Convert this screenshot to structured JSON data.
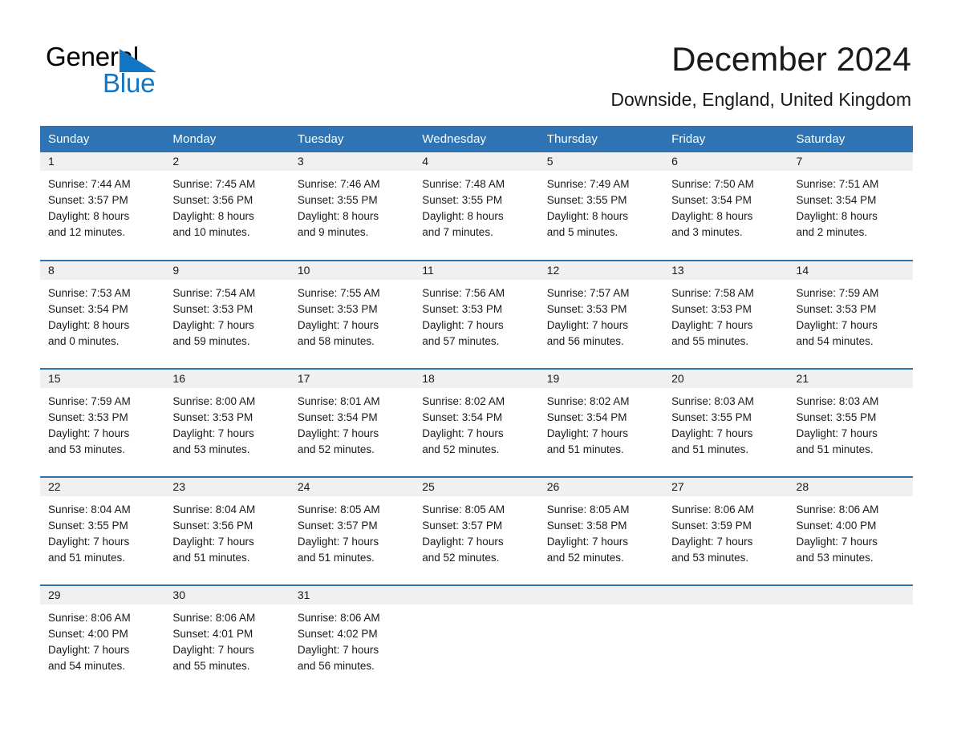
{
  "brand": {
    "name_dark": "General",
    "name_light": "Blue",
    "logo_triangle_color": "#1276c4",
    "accent_color": "#2e74b5",
    "daynum_band_color": "#f0f0f0"
  },
  "header": {
    "title": "December 2024",
    "subtitle": "Downside, England, United Kingdom"
  },
  "weekday_headers": [
    "Sunday",
    "Monday",
    "Tuesday",
    "Wednesday",
    "Thursday",
    "Friday",
    "Saturday"
  ],
  "weeks": [
    [
      {
        "day": "1",
        "sunrise": "Sunrise: 7:44 AM",
        "sunset": "Sunset: 3:57 PM",
        "daylight_line1": "Daylight: 8 hours",
        "daylight_line2": "and 12 minutes."
      },
      {
        "day": "2",
        "sunrise": "Sunrise: 7:45 AM",
        "sunset": "Sunset: 3:56 PM",
        "daylight_line1": "Daylight: 8 hours",
        "daylight_line2": "and 10 minutes."
      },
      {
        "day": "3",
        "sunrise": "Sunrise: 7:46 AM",
        "sunset": "Sunset: 3:55 PM",
        "daylight_line1": "Daylight: 8 hours",
        "daylight_line2": "and 9 minutes."
      },
      {
        "day": "4",
        "sunrise": "Sunrise: 7:48 AM",
        "sunset": "Sunset: 3:55 PM",
        "daylight_line1": "Daylight: 8 hours",
        "daylight_line2": "and 7 minutes."
      },
      {
        "day": "5",
        "sunrise": "Sunrise: 7:49 AM",
        "sunset": "Sunset: 3:55 PM",
        "daylight_line1": "Daylight: 8 hours",
        "daylight_line2": "and 5 minutes."
      },
      {
        "day": "6",
        "sunrise": "Sunrise: 7:50 AM",
        "sunset": "Sunset: 3:54 PM",
        "daylight_line1": "Daylight: 8 hours",
        "daylight_line2": "and 3 minutes."
      },
      {
        "day": "7",
        "sunrise": "Sunrise: 7:51 AM",
        "sunset": "Sunset: 3:54 PM",
        "daylight_line1": "Daylight: 8 hours",
        "daylight_line2": "and 2 minutes."
      }
    ],
    [
      {
        "day": "8",
        "sunrise": "Sunrise: 7:53 AM",
        "sunset": "Sunset: 3:54 PM",
        "daylight_line1": "Daylight: 8 hours",
        "daylight_line2": "and 0 minutes."
      },
      {
        "day": "9",
        "sunrise": "Sunrise: 7:54 AM",
        "sunset": "Sunset: 3:53 PM",
        "daylight_line1": "Daylight: 7 hours",
        "daylight_line2": "and 59 minutes."
      },
      {
        "day": "10",
        "sunrise": "Sunrise: 7:55 AM",
        "sunset": "Sunset: 3:53 PM",
        "daylight_line1": "Daylight: 7 hours",
        "daylight_line2": "and 58 minutes."
      },
      {
        "day": "11",
        "sunrise": "Sunrise: 7:56 AM",
        "sunset": "Sunset: 3:53 PM",
        "daylight_line1": "Daylight: 7 hours",
        "daylight_line2": "and 57 minutes."
      },
      {
        "day": "12",
        "sunrise": "Sunrise: 7:57 AM",
        "sunset": "Sunset: 3:53 PM",
        "daylight_line1": "Daylight: 7 hours",
        "daylight_line2": "and 56 minutes."
      },
      {
        "day": "13",
        "sunrise": "Sunrise: 7:58 AM",
        "sunset": "Sunset: 3:53 PM",
        "daylight_line1": "Daylight: 7 hours",
        "daylight_line2": "and 55 minutes."
      },
      {
        "day": "14",
        "sunrise": "Sunrise: 7:59 AM",
        "sunset": "Sunset: 3:53 PM",
        "daylight_line1": "Daylight: 7 hours",
        "daylight_line2": "and 54 minutes."
      }
    ],
    [
      {
        "day": "15",
        "sunrise": "Sunrise: 7:59 AM",
        "sunset": "Sunset: 3:53 PM",
        "daylight_line1": "Daylight: 7 hours",
        "daylight_line2": "and 53 minutes."
      },
      {
        "day": "16",
        "sunrise": "Sunrise: 8:00 AM",
        "sunset": "Sunset: 3:53 PM",
        "daylight_line1": "Daylight: 7 hours",
        "daylight_line2": "and 53 minutes."
      },
      {
        "day": "17",
        "sunrise": "Sunrise: 8:01 AM",
        "sunset": "Sunset: 3:54 PM",
        "daylight_line1": "Daylight: 7 hours",
        "daylight_line2": "and 52 minutes."
      },
      {
        "day": "18",
        "sunrise": "Sunrise: 8:02 AM",
        "sunset": "Sunset: 3:54 PM",
        "daylight_line1": "Daylight: 7 hours",
        "daylight_line2": "and 52 minutes."
      },
      {
        "day": "19",
        "sunrise": "Sunrise: 8:02 AM",
        "sunset": "Sunset: 3:54 PM",
        "daylight_line1": "Daylight: 7 hours",
        "daylight_line2": "and 51 minutes."
      },
      {
        "day": "20",
        "sunrise": "Sunrise: 8:03 AM",
        "sunset": "Sunset: 3:55 PM",
        "daylight_line1": "Daylight: 7 hours",
        "daylight_line2": "and 51 minutes."
      },
      {
        "day": "21",
        "sunrise": "Sunrise: 8:03 AM",
        "sunset": "Sunset: 3:55 PM",
        "daylight_line1": "Daylight: 7 hours",
        "daylight_line2": "and 51 minutes."
      }
    ],
    [
      {
        "day": "22",
        "sunrise": "Sunrise: 8:04 AM",
        "sunset": "Sunset: 3:55 PM",
        "daylight_line1": "Daylight: 7 hours",
        "daylight_line2": "and 51 minutes."
      },
      {
        "day": "23",
        "sunrise": "Sunrise: 8:04 AM",
        "sunset": "Sunset: 3:56 PM",
        "daylight_line1": "Daylight: 7 hours",
        "daylight_line2": "and 51 minutes."
      },
      {
        "day": "24",
        "sunrise": "Sunrise: 8:05 AM",
        "sunset": "Sunset: 3:57 PM",
        "daylight_line1": "Daylight: 7 hours",
        "daylight_line2": "and 51 minutes."
      },
      {
        "day": "25",
        "sunrise": "Sunrise: 8:05 AM",
        "sunset": "Sunset: 3:57 PM",
        "daylight_line1": "Daylight: 7 hours",
        "daylight_line2": "and 52 minutes."
      },
      {
        "day": "26",
        "sunrise": "Sunrise: 8:05 AM",
        "sunset": "Sunset: 3:58 PM",
        "daylight_line1": "Daylight: 7 hours",
        "daylight_line2": "and 52 minutes."
      },
      {
        "day": "27",
        "sunrise": "Sunrise: 8:06 AM",
        "sunset": "Sunset: 3:59 PM",
        "daylight_line1": "Daylight: 7 hours",
        "daylight_line2": "and 53 minutes."
      },
      {
        "day": "28",
        "sunrise": "Sunrise: 8:06 AM",
        "sunset": "Sunset: 4:00 PM",
        "daylight_line1": "Daylight: 7 hours",
        "daylight_line2": "and 53 minutes."
      }
    ],
    [
      {
        "day": "29",
        "sunrise": "Sunrise: 8:06 AM",
        "sunset": "Sunset: 4:00 PM",
        "daylight_line1": "Daylight: 7 hours",
        "daylight_line2": "and 54 minutes."
      },
      {
        "day": "30",
        "sunrise": "Sunrise: 8:06 AM",
        "sunset": "Sunset: 4:01 PM",
        "daylight_line1": "Daylight: 7 hours",
        "daylight_line2": "and 55 minutes."
      },
      {
        "day": "31",
        "sunrise": "Sunrise: 8:06 AM",
        "sunset": "Sunset: 4:02 PM",
        "daylight_line1": "Daylight: 7 hours",
        "daylight_line2": "and 56 minutes."
      },
      {
        "day": "",
        "sunrise": "",
        "sunset": "",
        "daylight_line1": "",
        "daylight_line2": ""
      },
      {
        "day": "",
        "sunrise": "",
        "sunset": "",
        "daylight_line1": "",
        "daylight_line2": ""
      },
      {
        "day": "",
        "sunrise": "",
        "sunset": "",
        "daylight_line1": "",
        "daylight_line2": ""
      },
      {
        "day": "",
        "sunrise": "",
        "sunset": "",
        "daylight_line1": "",
        "daylight_line2": ""
      }
    ]
  ]
}
